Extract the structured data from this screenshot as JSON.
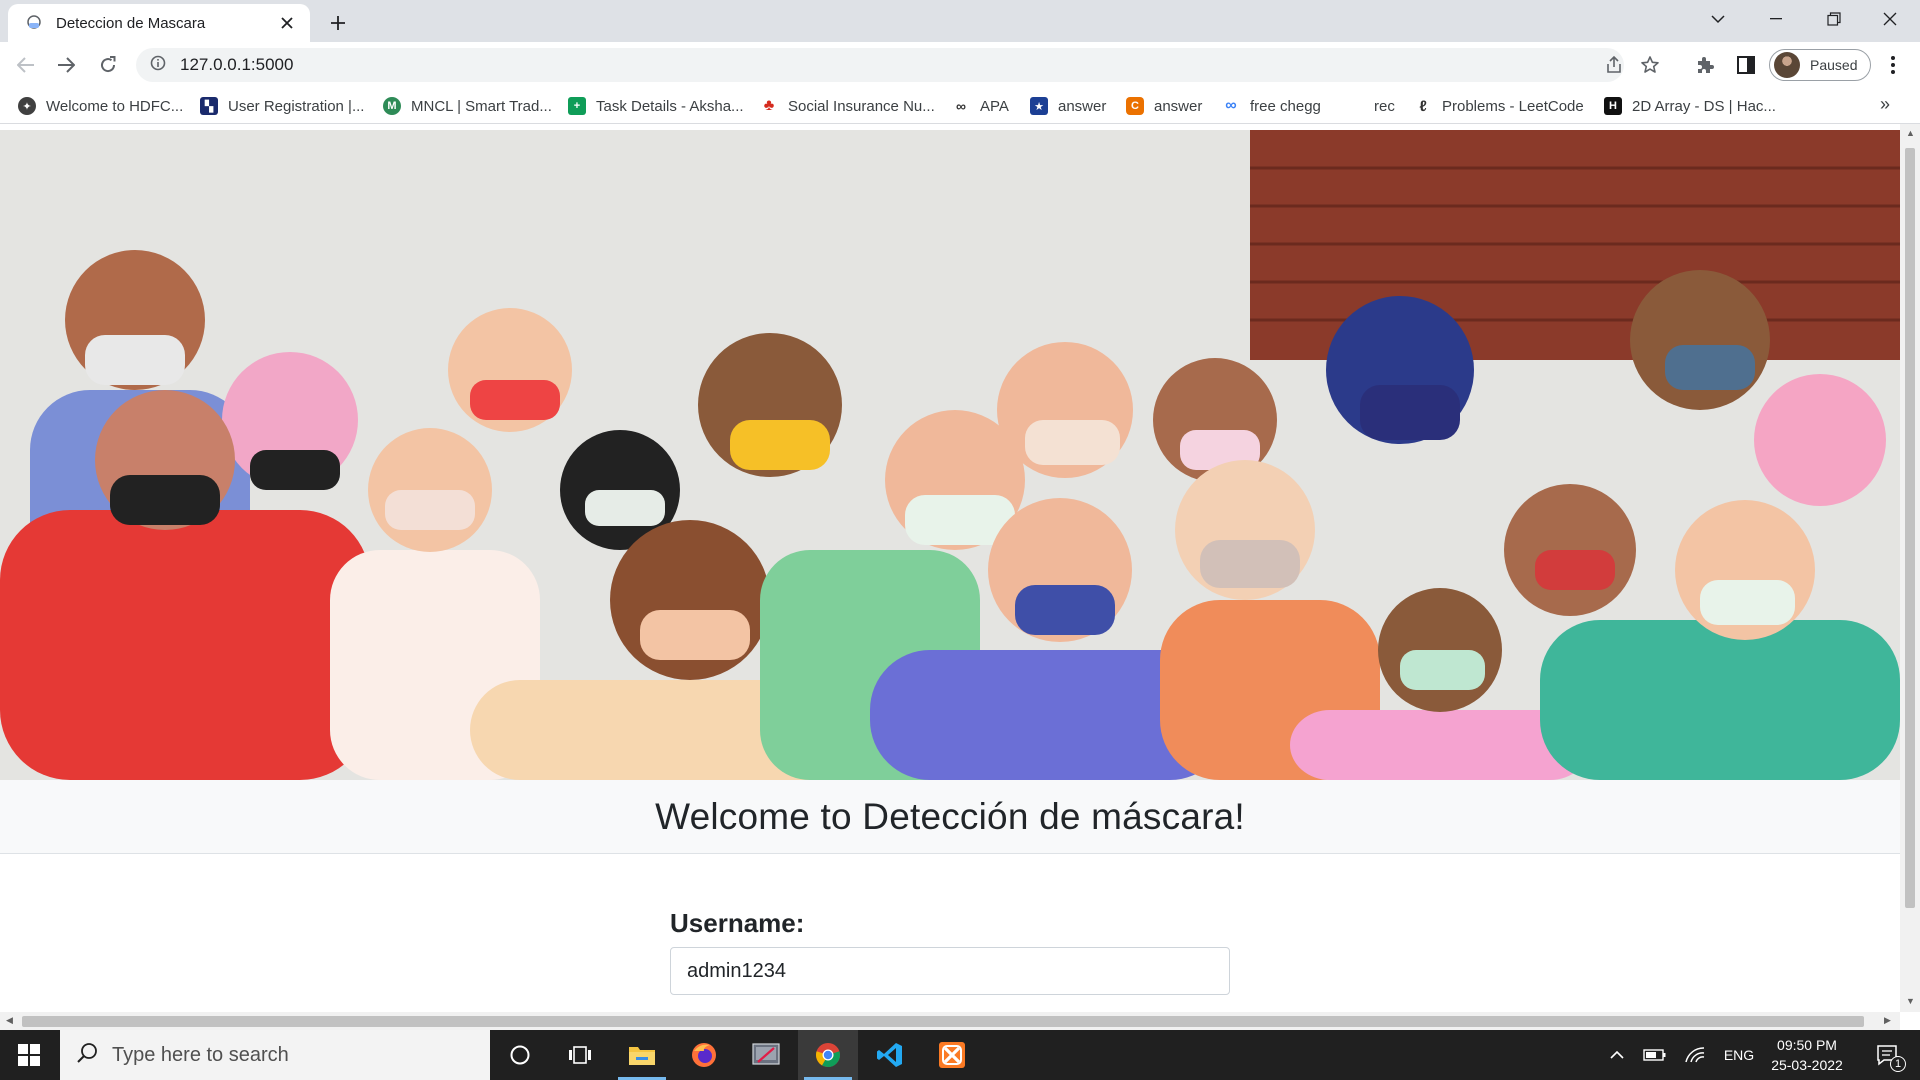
{
  "browser": {
    "tab_title": "Deteccion de Mascara",
    "url": "127.0.0.1:5000",
    "profile_label": "Paused"
  },
  "bookmarks": [
    {
      "label": "Welcome to HDFC...",
      "icon": "hdfc-icon",
      "color": "#404040"
    },
    {
      "label": "User Registration |...",
      "icon": "registration-icon",
      "color": "#1a2a6c"
    },
    {
      "label": "MNCL | Smart Trad...",
      "icon": "mncl-icon",
      "color": "#2e8b57"
    },
    {
      "label": "Task Details - Aksha...",
      "icon": "sheets-icon",
      "color": "#0f9d58"
    },
    {
      "label": "Social Insurance Nu...",
      "icon": "maple-leaf-icon",
      "color": "#d52b1e"
    },
    {
      "label": "APA",
      "icon": "apa-icon",
      "color": "#333333"
    },
    {
      "label": "answer",
      "icon": "star-badge-icon",
      "color": "#1c3f94"
    },
    {
      "label": "answer",
      "icon": "chegg-icon",
      "color": "#eb7100"
    },
    {
      "label": "free chegg",
      "icon": "infinity-icon",
      "color": "#3b82f6"
    },
    {
      "label": "rec",
      "icon": "",
      "color": ""
    },
    {
      "label": "Problems - LeetCode",
      "icon": "leetcode-icon",
      "color": "#f89f1b"
    },
    {
      "label": "2D Array - DS | Hac...",
      "icon": "hackerrank-icon",
      "color": "#111111"
    }
  ],
  "page": {
    "welcome_title": "Welcome to Detección de máscara!",
    "username_label": "Username:",
    "username_value": "admin1234"
  },
  "taskbar": {
    "search_placeholder": "Type here to search",
    "language": "ENG",
    "time": "09:50 PM",
    "date": "25-03-2022",
    "notification_count": "1"
  },
  "colors": {
    "tabstrip_bg": "#dee1e6",
    "taskbar_bg": "#202020",
    "welcome_bar_bg": "#f8f9fa"
  }
}
